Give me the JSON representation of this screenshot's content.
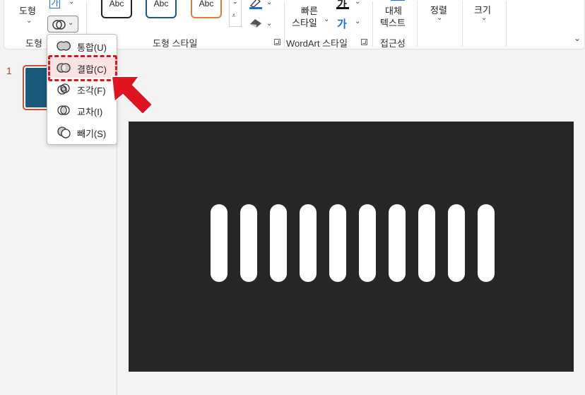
{
  "ribbon": {
    "shape_label": "도형",
    "group_shape": "도형",
    "group_shape_style": "도형 스타일",
    "group_wordart": "WordArt 스타일",
    "group_accessibility": "접근성",
    "style_samples": [
      "Abc",
      "Abc",
      "Abc"
    ],
    "style_colors": [
      "#222222",
      "#1c5b7a",
      "#e07b39"
    ],
    "quick_style_line1": "빠른",
    "quick_style_line2": "스타일",
    "alt_text_line1": "대체",
    "alt_text_line2": "텍스트",
    "arrange": "정렬",
    "size": "크기",
    "text_box_glyph": "가",
    "wordart_glyph1": "가",
    "wordart_glyph2": "가"
  },
  "merge_menu": {
    "items": [
      {
        "label": "통합(U)",
        "icon": "union-icon"
      },
      {
        "label": "결합(C)",
        "icon": "combine-icon"
      },
      {
        "label": "조각(F)",
        "icon": "fragment-icon"
      },
      {
        "label": "교차(I)",
        "icon": "intersect-icon"
      },
      {
        "label": "빼기(S)",
        "icon": "subtract-icon"
      }
    ],
    "highlighted_index": 1
  },
  "slides": {
    "current_number": "1",
    "thumbnail_color": "#1b5a7a"
  },
  "slide_canvas": {
    "background": "#252627",
    "bar_count": 10,
    "bar_color": "#ffffff"
  },
  "annotation": {
    "highlight_color": "#e0141e"
  }
}
